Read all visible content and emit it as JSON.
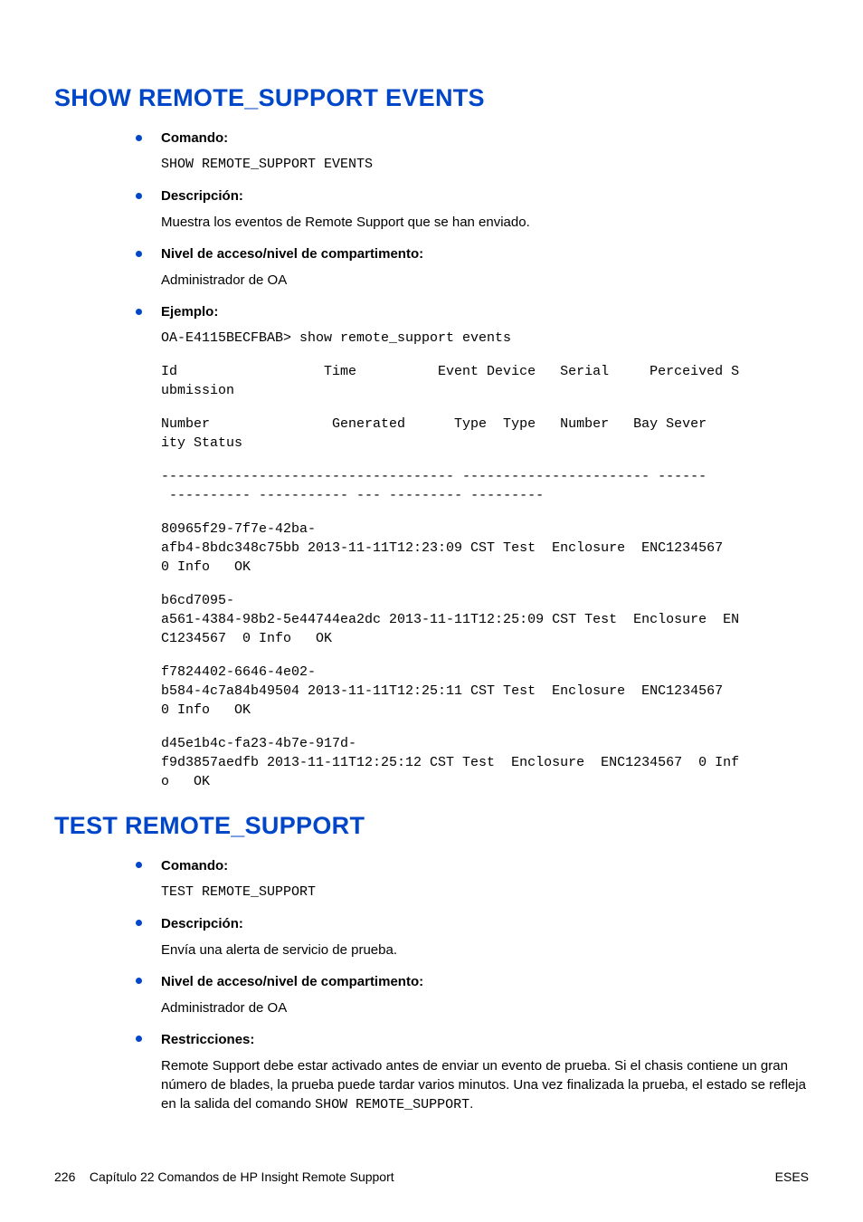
{
  "section1": {
    "heading": "SHOW REMOTE_SUPPORT EVENTS",
    "items": {
      "comando": {
        "label": "Comando:",
        "code": "SHOW REMOTE_SUPPORT EVENTS"
      },
      "descripcion": {
        "label": "Descripción:",
        "text": "Muestra los eventos de Remote Support que se han enviado."
      },
      "nivel": {
        "label": "Nivel de acceso/nivel de compartimento:",
        "text": "Administrador de OA"
      },
      "ejemplo": {
        "label": "Ejemplo:",
        "line0": "OA-E4115BECFBAB> show remote_support events",
        "line1": "Id                  Time          Event Device   Serial     Perceived S\nubmission",
        "line2": "Number               Generated      Type  Type   Number   Bay Sever\nity Status",
        "line3": "------------------------------------ ----------------------- ------\n ---------- ----------- --- --------- ---------",
        "line4": "80965f29-7f7e-42ba-\nafb4-8bdc348c75bb 2013-11-11T12:23:09 CST Test  Enclosure  ENC1234567  \n0 Info   OK",
        "line5": "b6cd7095-\na561-4384-98b2-5e44744ea2dc 2013-11-11T12:25:09 CST Test  Enclosure  EN\nC1234567  0 Info   OK",
        "line6": "f7824402-6646-4e02-\nb584-4c7a84b49504 2013-11-11T12:25:11 CST Test  Enclosure  ENC1234567  \n0 Info   OK",
        "line7": "d45e1b4c-fa23-4b7e-917d-\nf9d3857aedfb 2013-11-11T12:25:12 CST Test  Enclosure  ENC1234567  0 Inf\no   OK"
      }
    }
  },
  "section2": {
    "heading": "TEST REMOTE_SUPPORT",
    "items": {
      "comando": {
        "label": "Comando:",
        "code": "TEST REMOTE_SUPPORT"
      },
      "descripcion": {
        "label": "Descripción:",
        "text": "Envía una alerta de servicio de prueba."
      },
      "nivel": {
        "label": "Nivel de acceso/nivel de compartimento:",
        "text": "Administrador de OA"
      },
      "restricciones": {
        "label": "Restricciones:",
        "text_prefix": "Remote Support debe estar activado antes de enviar un evento de prueba. Si el chasis contiene un gran número de blades, la prueba puede tardar varios minutos. Una vez finalizada la prueba, el estado se refleja en la salida del comando ",
        "code": "SHOW REMOTE_SUPPORT",
        "text_suffix": "."
      }
    }
  },
  "footer": {
    "page": "226",
    "chapter": "Capítulo 22   Comandos de HP Insight Remote Support",
    "right": "ESES"
  }
}
